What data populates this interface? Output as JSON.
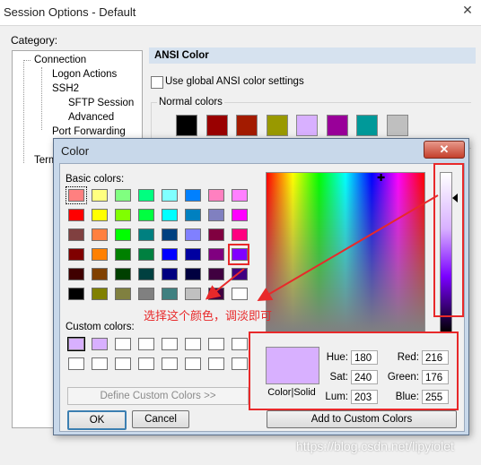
{
  "background_window": {
    "title": "Session Options - Default",
    "close_glyph": "✕",
    "category_label": "Category:",
    "tree": [
      "Connection",
      "Logon Actions",
      "SSH2",
      "SFTP Session",
      "Advanced",
      "Port Forwarding",
      "Term"
    ],
    "section_header": "ANSI Color",
    "global_ansi_checkbox_label": "Use global ANSI color settings",
    "global_ansi_checked": false,
    "normal_colors_label": "Normal colors",
    "normal_colors": [
      "#000000",
      "#990000",
      "#a31b00",
      "#999900",
      "#d8b0ff",
      "#990099",
      "#009999",
      "#bfbfbf"
    ]
  },
  "color_dialog": {
    "title": "Color",
    "close_glyph": "✕",
    "basic_colors_label": "Basic colors:",
    "basic_colors": [
      [
        "#ff8080",
        "#ffff80",
        "#80ff80",
        "#00ff80",
        "#80ffff",
        "#0080ff",
        "#ff80c0",
        "#ff80ff"
      ],
      [
        "#ff0000",
        "#ffff00",
        "#80ff00",
        "#00ff40",
        "#00ffff",
        "#0080c0",
        "#8080c0",
        "#ff00ff"
      ],
      [
        "#804040",
        "#ff8040",
        "#00ff00",
        "#008080",
        "#004080",
        "#8080ff",
        "#800040",
        "#ff0080"
      ],
      [
        "#800000",
        "#ff8000",
        "#008000",
        "#008040",
        "#0000ff",
        "#0000a0",
        "#800080",
        "#8000ff"
      ],
      [
        "#400000",
        "#804000",
        "#004000",
        "#004040",
        "#000080",
        "#000040",
        "#400040",
        "#400080"
      ],
      [
        "#000000",
        "#808000",
        "#808040",
        "#808080",
        "#408080",
        "#c0c0c0",
        "#400040",
        "#ffffff"
      ]
    ],
    "selected_basic": [
      0,
      0
    ],
    "custom_colors_label": "Custom colors:",
    "custom_colors": [
      [
        "#d8b0ff",
        "#d8b0ff",
        "#ffffff",
        "#ffffff",
        "#ffffff",
        "#ffffff",
        "#ffffff",
        "#ffffff"
      ],
      [
        "#ffffff",
        "#ffffff",
        "#ffffff",
        "#ffffff",
        "#ffffff",
        "#ffffff",
        "#ffffff",
        "#ffffff"
      ]
    ],
    "define_custom_label": "Define Custom Colors >>",
    "ok_label": "OK",
    "cancel_label": "Cancel",
    "preview_color": "#d8b0ff",
    "preview_label": "Color|Solid",
    "hue_label": "Hue:",
    "hue": "180",
    "sat_label": "Sat:",
    "sat": "240",
    "lum_label": "Lum:",
    "lum": "203",
    "red_label": "Red:",
    "red": "216",
    "green_label": "Green:",
    "green": "176",
    "blue_label": "Blue:",
    "blue": "255",
    "add_custom_label": "Add to Custom Colors"
  },
  "annotation": {
    "text": "选择这个颜色，调淡即可",
    "color": "#e8292a"
  },
  "watermark": "https://blog.csdn.net/lipyiolet"
}
